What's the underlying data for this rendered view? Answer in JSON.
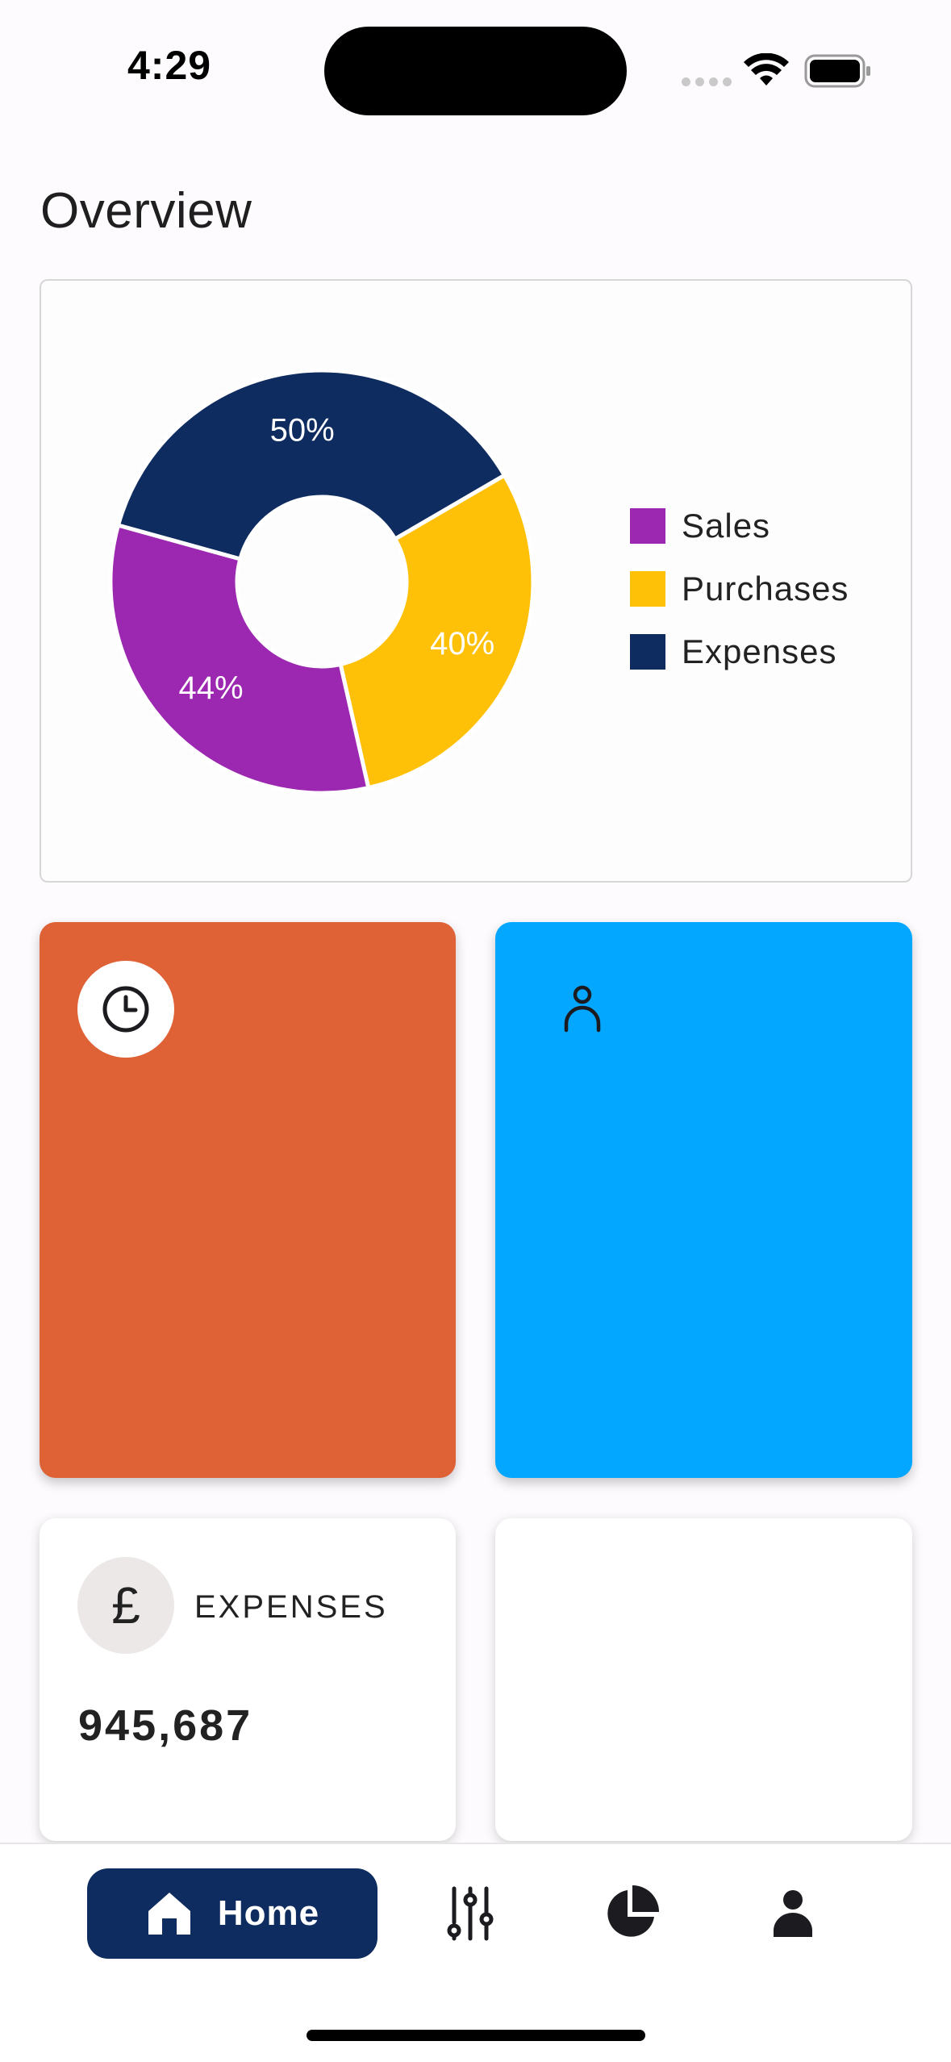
{
  "status_bar": {
    "time": "4:29"
  },
  "page": {
    "title": "Overview"
  },
  "colors": {
    "sales": "#9c27b0",
    "purchases": "#ffc107",
    "expenses": "#0f2c60",
    "tile_orange": "#df6237",
    "tile_blue": "#03a7ff",
    "nav_active": "#0f2c60"
  },
  "chart_data": {
    "type": "pie",
    "series": [
      {
        "name": "Expenses",
        "value": 50,
        "label": "50%",
        "color": "#0f2c60"
      },
      {
        "name": "Purchases",
        "value": 40,
        "label": "40%",
        "color": "#ffc107"
      },
      {
        "name": "Sales",
        "value": 44,
        "label": "44%",
        "color": "#9c27b0"
      }
    ],
    "legend": {
      "position": "right",
      "entries": [
        {
          "label": "Sales",
          "color": "#9c27b0"
        },
        {
          "label": "Purchases",
          "color": "#ffc107"
        },
        {
          "label": "Expenses",
          "color": "#0f2c60"
        }
      ]
    },
    "donut": true
  },
  "tiles": [
    {
      "icon": "clock-icon",
      "color": "#df6237"
    },
    {
      "icon": "person-outline-icon",
      "color": "#03a7ff"
    }
  ],
  "stats": {
    "expenses": {
      "icon": "pound-icon",
      "symbol": "£",
      "label": "EXPENSES",
      "value": "945,687"
    }
  },
  "bottom_nav": {
    "items": [
      {
        "label": "Home",
        "icon": "home-icon",
        "active": true
      },
      {
        "label": "",
        "icon": "sliders-icon",
        "active": false
      },
      {
        "label": "",
        "icon": "pie-chart-icon",
        "active": false
      },
      {
        "label": "",
        "icon": "person-icon",
        "active": false
      }
    ]
  }
}
